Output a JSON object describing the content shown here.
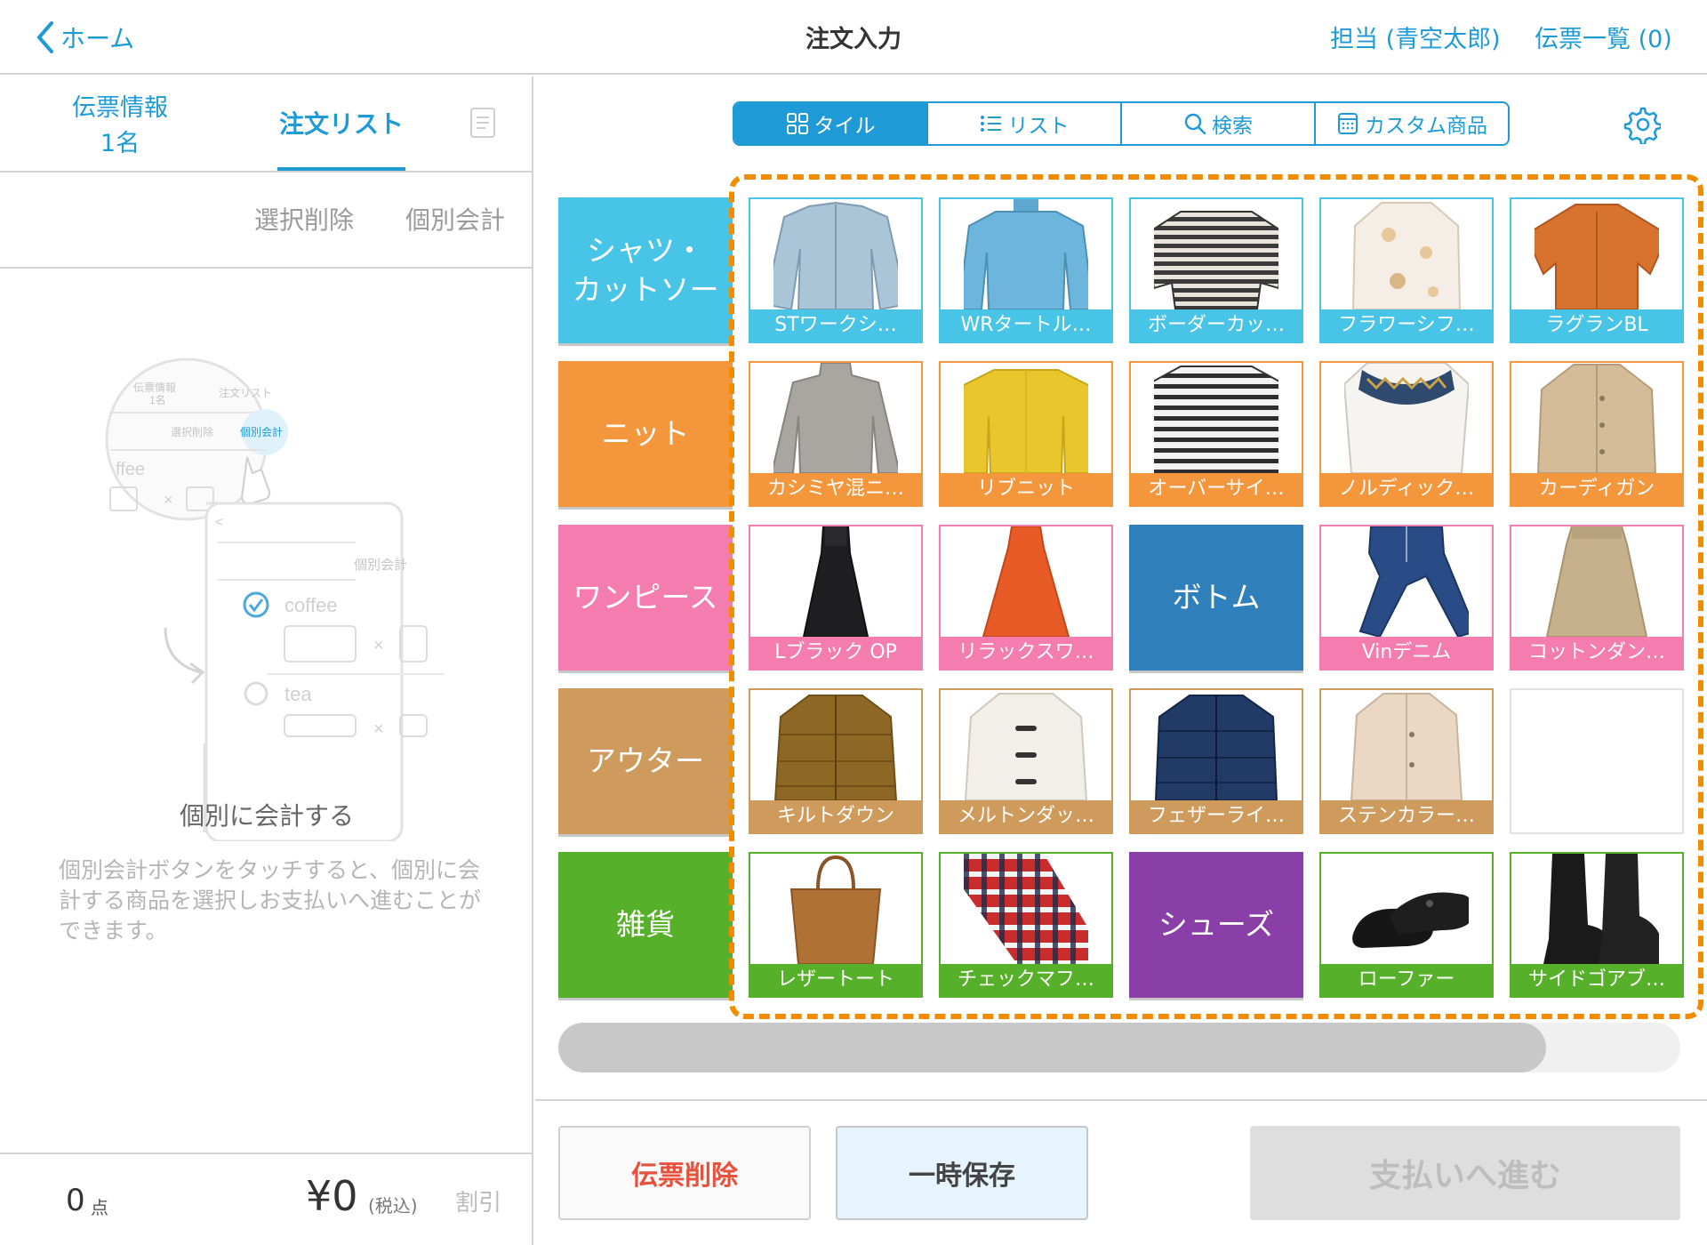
{
  "header": {
    "back_label": "ホーム",
    "title": "注文入力",
    "staff_label": "担当 (青空太郎)",
    "slips_label": "伝票一覧 (0)"
  },
  "left_panel": {
    "tab_info_line1": "伝票情報",
    "tab_info_line2": "1名",
    "tab_order": "注文リスト",
    "select_delete": "選択削除",
    "individual_pay": "個別会計",
    "illustration": {
      "tab_info": "伝票情報",
      "tab_info_count": "1名",
      "tab_order": "注文リスト",
      "select_delete": "選択削除",
      "individual_pay": "個別会計",
      "coffee_partial": "ffee",
      "times": "×",
      "back_chevron": "<",
      "item_coffee": "coffee",
      "item_tea": "tea"
    },
    "empty_title": "個別に会計する",
    "empty_desc": "個別会計ボタンをタッチすると、個別に会計する商品を選択しお支払いへ進むことができます。",
    "count": "0",
    "count_unit": "点",
    "total": "¥0",
    "tax_label": "(税込)",
    "discount": "割引"
  },
  "view_tabs": [
    "タイル",
    "リスト",
    "検索",
    "カスタム商品"
  ],
  "active_tab": 0,
  "categories": [
    {
      "label": "シャツ・\nカットソー",
      "color": "#47c4e6"
    },
    {
      "label": "ニット",
      "color": "#f4963c"
    },
    {
      "label": "ワンピース",
      "color": "#f47cae"
    },
    {
      "label": "アウター",
      "color": "#cf9b5c"
    },
    {
      "label": "雑貨",
      "color": "#57b02a"
    }
  ],
  "grid_rows": [
    [
      {
        "label": "STワークシ…",
        "icon": "shirt"
      },
      {
        "label": "WRタートル…",
        "icon": "turtleneck"
      },
      {
        "label": "ボーダーカッ…",
        "icon": "striped-tee"
      },
      {
        "label": "フラワーシフ…",
        "icon": "floral-blouse"
      },
      {
        "label": "ラグランBL",
        "icon": "raglan-blouse"
      }
    ],
    [
      {
        "label": "カシミヤ混ニ…",
        "icon": "cashmere-knit"
      },
      {
        "label": "リブニット",
        "icon": "rib-knit"
      },
      {
        "label": "オーバーサイ…",
        "icon": "oversize-knit"
      },
      {
        "label": "ノルディック…",
        "icon": "nordic-knit"
      },
      {
        "label": "カーディガン",
        "icon": "cardigan"
      }
    ],
    [
      {
        "label": "Lブラック OP",
        "icon": "black-dress"
      },
      {
        "label": "リラックスワ…",
        "icon": "orange-dress"
      },
      {
        "label": "ボトム",
        "icon": "",
        "type": "category",
        "color": "#2e7fba"
      },
      {
        "label": "Vinデニム",
        "icon": "denim"
      },
      {
        "label": "コットンダン…",
        "icon": "cotton-skirt"
      }
    ],
    [
      {
        "label": "キルトダウン",
        "icon": "down-jacket"
      },
      {
        "label": "メルトンダッ…",
        "icon": "duffle-coat"
      },
      {
        "label": "フェザーライ…",
        "icon": "feather-jacket"
      },
      {
        "label": "ステンカラー…",
        "icon": "stand-collar-coat"
      },
      {
        "label": "",
        "icon": "",
        "type": "empty"
      }
    ],
    [
      {
        "label": "レザートート",
        "icon": "tote-bag"
      },
      {
        "label": "チェックマフ…",
        "icon": "check-muffler"
      },
      {
        "label": "シューズ",
        "icon": "",
        "type": "category",
        "color": "#8a3ea8"
      },
      {
        "label": "ローファー",
        "icon": "loafers"
      },
      {
        "label": "サイドゴアブ…",
        "icon": "side-gore-boots"
      }
    ]
  ],
  "scroll_progress": 0.88,
  "actions": {
    "delete_slip": "伝票削除",
    "hold": "一時保存",
    "pay": "支払いへ進む"
  },
  "colors": {
    "accent": "#1e9bd7",
    "highlight_dash": "#f08c00",
    "danger_text": "#e8513c"
  }
}
